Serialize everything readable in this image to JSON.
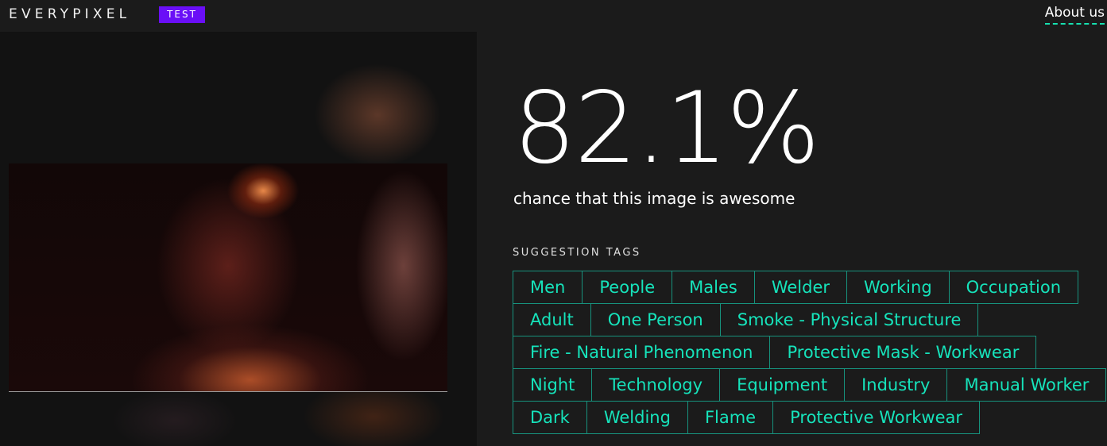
{
  "header": {
    "logo": "EVERYPIXEL",
    "badge": "TEST",
    "about_link": "About us"
  },
  "result": {
    "score": "82.1%",
    "caption": "chance that this image is awesome"
  },
  "tags": {
    "title": "SUGGESTION TAGS",
    "rows": [
      [
        "Men",
        "People",
        "Males",
        "Welder",
        "Working",
        "Occupation"
      ],
      [
        "Adult",
        "One Person",
        "Smoke - Physical Structure"
      ],
      [
        "Fire - Natural Phenomenon",
        "Protective Mask - Workwear"
      ],
      [
        "Night",
        "Technology",
        "Equipment",
        "Industry",
        "Manual Worker"
      ],
      [
        "Dark",
        "Welding",
        "Flame",
        "Protective Workwear"
      ]
    ]
  },
  "colors": {
    "accent": "#16e3bb",
    "tag_border": "#17927d",
    "badge": "#6a0ff7",
    "background": "#1b1b1b"
  }
}
